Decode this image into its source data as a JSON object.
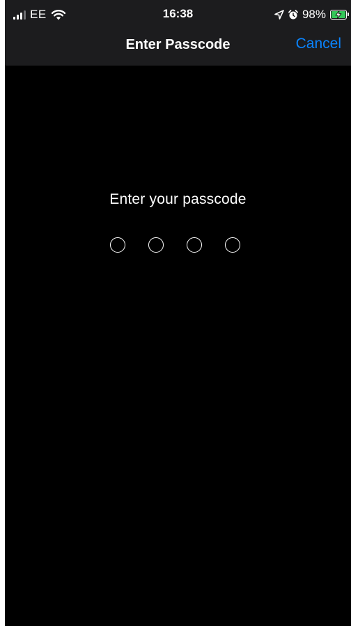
{
  "status_bar": {
    "carrier": "EE",
    "time": "16:38",
    "battery_percent": "98%",
    "battery_level": 0.98,
    "charging": true,
    "icons": [
      "signal-icon",
      "wifi-icon",
      "location-icon",
      "alarm-icon",
      "battery-icon"
    ]
  },
  "nav": {
    "title": "Enter Passcode",
    "cancel_label": "Cancel"
  },
  "passcode": {
    "prompt": "Enter your passcode",
    "digit_count": 4,
    "filled_count": 0
  },
  "colors": {
    "accent": "#0a84ff",
    "background": "#000000",
    "bar_background": "#1c1c1e",
    "battery_fill": "#34c759"
  }
}
